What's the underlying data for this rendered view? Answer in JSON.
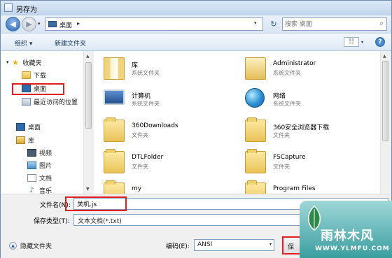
{
  "window": {
    "title": "另存为"
  },
  "address": {
    "location": "桌面",
    "separator": "▸",
    "search_placeholder": "搜索 桌面"
  },
  "toolbar": {
    "organize": "组织 ▾",
    "new_folder": "新建文件夹"
  },
  "sidebar": {
    "items": [
      {
        "label": "收藏夹",
        "icon": "star-icon"
      },
      {
        "label": "下载",
        "icon": "folder-icon"
      },
      {
        "label": "桌面",
        "icon": "desktop-icon"
      },
      {
        "label": "最近访问的位置",
        "icon": "recent-places-icon"
      },
      {
        "label": "桌面",
        "icon": "desktop-icon"
      },
      {
        "label": "库",
        "icon": "library-icon"
      },
      {
        "label": "视频",
        "icon": "video-icon"
      },
      {
        "label": "图片",
        "icon": "picture-icon"
      },
      {
        "label": "文档",
        "icon": "document-icon"
      },
      {
        "label": "音乐",
        "icon": "music-icon"
      }
    ]
  },
  "files": [
    {
      "name": "库",
      "type": "系统文件夹",
      "icon": "library-folder-icon"
    },
    {
      "name": "Administrator",
      "type": "系统文件夹",
      "icon": "user-folder-icon"
    },
    {
      "name": "计算机",
      "type": "系统文件夹",
      "icon": "computer-icon"
    },
    {
      "name": "网络",
      "type": "系统文件夹",
      "icon": "network-icon"
    },
    {
      "name": "360Downloads",
      "type": "文件夹",
      "icon": "folder-icon"
    },
    {
      "name": "360安全浏览器下载",
      "type": "文件夹",
      "icon": "folder-icon"
    },
    {
      "name": "DTLFolder",
      "type": "文件夹",
      "icon": "folder-icon"
    },
    {
      "name": "FSCapture",
      "type": "文件夹",
      "icon": "folder-icon"
    },
    {
      "name": "my",
      "type": "",
      "icon": "folder-icon"
    },
    {
      "name": "Program Files",
      "type": "",
      "icon": "folder-icon"
    }
  ],
  "bottom": {
    "filename_label": "文件名(N):",
    "filename_value": "关机.js",
    "filetype_label": "保存类型(T):",
    "filetype_value": "文本文档(*.txt)",
    "hide_folders": "隐藏文件夹",
    "encoding_label": "编码(E):",
    "encoding_value": "ANSI",
    "save_label": "保"
  },
  "watermark": {
    "brand": "雨林木风",
    "url": "WWW.YLMFU.COM"
  }
}
